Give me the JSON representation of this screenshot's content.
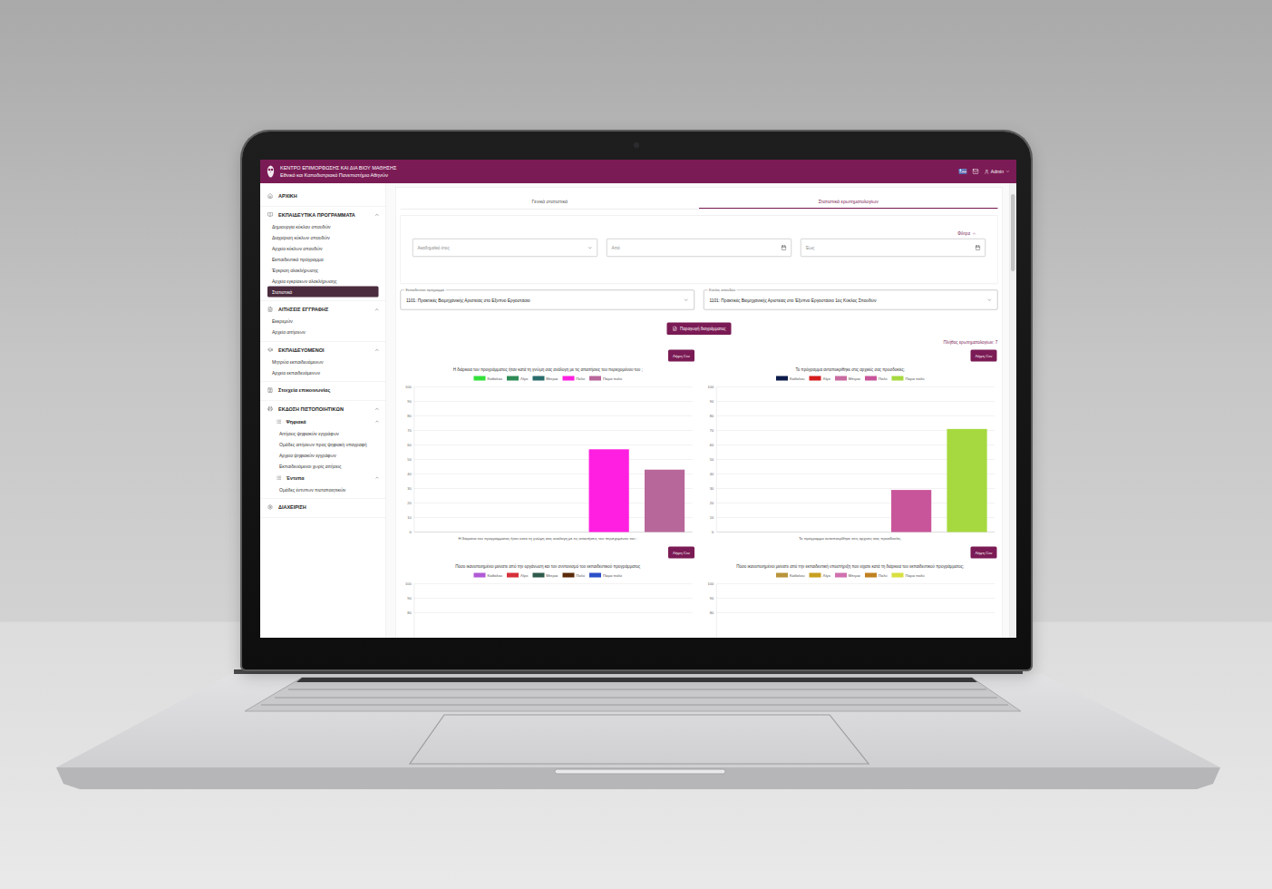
{
  "header": {
    "title": "ΚΕΝΤΡΟ ΕΠΙΜΟΡΦΩΣΗΣ ΚΑΙ ΔΙΑ ΒΙΟΥ ΜΑΘΗΣΗΣ",
    "subtitle": "Εθνικό και Καποδιστριακό Πανεπιστήμιο Αθηνών",
    "user": "Admin"
  },
  "sidebar": {
    "sections": [
      {
        "kind": "link",
        "label": "ΑΡΧΙΚΗ",
        "items": []
      },
      {
        "kind": "group",
        "label": "ΕΚΠΑΙΔΕΥΤΙΚΑ ΠΡΟΓΡΑΜΜΑΤΑ",
        "expanded": true,
        "items": [
          {
            "kind": "link",
            "label": "Δημιουργία κύκλου σπουδών",
            "selected": false
          },
          {
            "kind": "link",
            "label": "Διαχείριση κύκλων σπουδών",
            "selected": false
          },
          {
            "kind": "link",
            "label": "Αρχείο κύκλων σπουδών",
            "selected": false
          },
          {
            "kind": "link",
            "label": "Εκπαιδευτικό πρόγραμμα",
            "selected": false
          },
          {
            "kind": "link",
            "label": "Έγκριση ολοκλήρωσης",
            "selected": false
          },
          {
            "kind": "link",
            "label": "Αρχείο εγκρίσεων ολοκλήρωσης",
            "selected": false
          },
          {
            "kind": "link",
            "label": "Στατιστικά",
            "selected": true
          }
        ]
      },
      {
        "kind": "group",
        "label": "ΑΙΤΗΣΕΙΣ ΕΓΓΡΑΦΗΣ",
        "expanded": true,
        "items": [
          {
            "kind": "link",
            "label": "Εκκρεμών",
            "selected": false
          },
          {
            "kind": "link",
            "label": "Αρχείο αιτήσεων",
            "selected": false
          }
        ]
      },
      {
        "kind": "group",
        "label": "ΕΚΠΑΙΔΕΥΟΜΕΝΟΙ",
        "expanded": true,
        "items": [
          {
            "kind": "link",
            "label": "Μητρώο εκπαιδευόμενων",
            "selected": false
          },
          {
            "kind": "link",
            "label": "Αρχείο εκπαιδευόμενων",
            "selected": false
          }
        ]
      },
      {
        "kind": "link",
        "label": "Στοιχεία επικοινωνίας",
        "items": []
      },
      {
        "kind": "group",
        "label": "ΕΚΔΟΣΗ ΠΙΣΤΟΠΟΙΗΤΙΚΩΝ",
        "expanded": true,
        "items": [
          {
            "kind": "subgroup",
            "label": "Ψηφιακά",
            "expanded": true,
            "items": [
              {
                "kind": "link",
                "label": "Αιτήσεις ψηφιακών εγγράφων",
                "selected": false
              },
              {
                "kind": "link",
                "label": "Ομάδες αιτήσεων προς ψηφιακή υπογραφή",
                "selected": false
              },
              {
                "kind": "link",
                "label": "Αρχείο ψηφιακών εγγράφων",
                "selected": false
              },
              {
                "kind": "link",
                "label": "Εκπαιδευόμενοι χωρίς αιτήσεις",
                "selected": false
              }
            ]
          },
          {
            "kind": "subgroup",
            "label": "Έντυπα",
            "expanded": true,
            "items": [
              {
                "kind": "link",
                "label": "Ομάδες έντυπων πιστοποιητικών",
                "selected": false
              }
            ]
          }
        ]
      },
      {
        "kind": "link",
        "label": "ΔΙΑΧΕΙΡΙΣΗ",
        "items": []
      }
    ]
  },
  "tabs": [
    {
      "label": "Γενικά στατιστικά",
      "selected": false
    },
    {
      "label": "Στατιστικά ερωτηματολογίων",
      "selected": true
    }
  ],
  "filters": {
    "label": "Φίλτρα",
    "expanded": true,
    "fields": [
      {
        "kind": "select",
        "placeholder": "Ακαδημαϊκό έτος"
      },
      {
        "kind": "date",
        "placeholder": "Από"
      },
      {
        "kind": "date",
        "placeholder": "Έως"
      }
    ]
  },
  "selects": [
    {
      "label": "Εκπαιδευτικό πρόγραμμα",
      "value": "1101: Πρακτικές Βιομηχανικής Αριστείας στο Εξυπνο Εργοστάσιο"
    },
    {
      "label": "Κύκλος σπουδών",
      "value": "1101: Πρακτικές Βιομηχανικής Αριστείας στο Έξυπνο Εργοστάσιο 1ος Κύκλος Σπουδών"
    }
  ],
  "generate_button": "Παραγωγή διαγράμματος",
  "count": "Πλήθος ερωτηματολογίων: 7",
  "charts": [
    {
      "download": "Λήψη Csv",
      "title": "Η διάρκεια του προγράμματος ήταν κατά τη γνώμη σας ανάλογη με τις απαιτήσεις του περιεχομένου του ;",
      "legend": [
        {
          "label": "Καθόλου",
          "color": "#33e03a"
        },
        {
          "label": "Λίγο",
          "color": "#2e8b57"
        },
        {
          "label": "Μέτρια",
          "color": "#2a6b6b"
        },
        {
          "label": "Πολύ",
          "color": "#ff1fe0"
        },
        {
          "label": "Πάρα πολύ",
          "color": "#b8679a"
        }
      ],
      "ticks": [
        "100",
        "90",
        "80",
        "70",
        "60",
        "50",
        "40",
        "30",
        "20",
        "10",
        "0"
      ],
      "values": [
        0,
        0,
        0,
        57,
        43
      ],
      "x_label": "Η διάρκεια του προγράμματος ήταν κατά τη γνώμη σας ανάλογη με τις απαιτήσεις του περιεχομένου του ;"
    },
    {
      "download": "Λήψη Csv",
      "title": "Το πρόγραμμα ανταποκρίθηκε στις αρχικές σας προσδοκίες;",
      "legend": [
        {
          "label": "Καθόλου",
          "color": "#0d1a4a"
        },
        {
          "label": "Λίγο",
          "color": "#d41c1c"
        },
        {
          "label": "Μέτρια",
          "color": "#c86ba0"
        },
        {
          "label": "Πολύ",
          "color": "#c8559a"
        },
        {
          "label": "Πάρα πολύ",
          "color": "#a6d93f"
        }
      ],
      "ticks": [
        "100",
        "90",
        "80",
        "70",
        "60",
        "50",
        "40",
        "30",
        "20",
        "10",
        "0"
      ],
      "values": [
        0,
        0,
        0,
        29,
        71
      ],
      "x_label": "Το πρόγραμμα ανταποκρίθηκε στις αρχικές σας προσδοκίες."
    },
    {
      "download": "Λήψη Csv",
      "title": "Πόσο ικανοποιημένοι μείνατε από την οργάνωση και τον συντονισμό του εκπαιδευτικού προγράμματος",
      "legend": [
        {
          "label": "Καθόλου",
          "color": "#b05ad6"
        },
        {
          "label": "Λίγο",
          "color": "#d62f3a"
        },
        {
          "label": "Μέτρια",
          "color": "#2e5a4a"
        },
        {
          "label": "Πολύ",
          "color": "#5a2a0a"
        },
        {
          "label": "Πάρα πολύ",
          "color": "#2d4fc8"
        }
      ],
      "ticks": [
        "100",
        "90",
        "80"
      ],
      "values": []
    },
    {
      "download": "Λήψη Csv",
      "title": "Πόσο ικανοποιημένοι μείνατε από την εκπαιδευτική υποστήριξη που είχατε κατά τη διάρκεια του εκπαιδευτικού προγράμματος;",
      "legend": [
        {
          "label": "Καθόλου",
          "color": "#b8943a"
        },
        {
          "label": "Λίγο",
          "color": "#c8a020"
        },
        {
          "label": "Μέτρια",
          "color": "#d070b0"
        },
        {
          "label": "Πολύ",
          "color": "#c08020"
        },
        {
          "label": "Πάρα πολύ",
          "color": "#d8e040"
        }
      ],
      "ticks": [
        "100",
        "90",
        "80"
      ],
      "values": []
    }
  ]
}
